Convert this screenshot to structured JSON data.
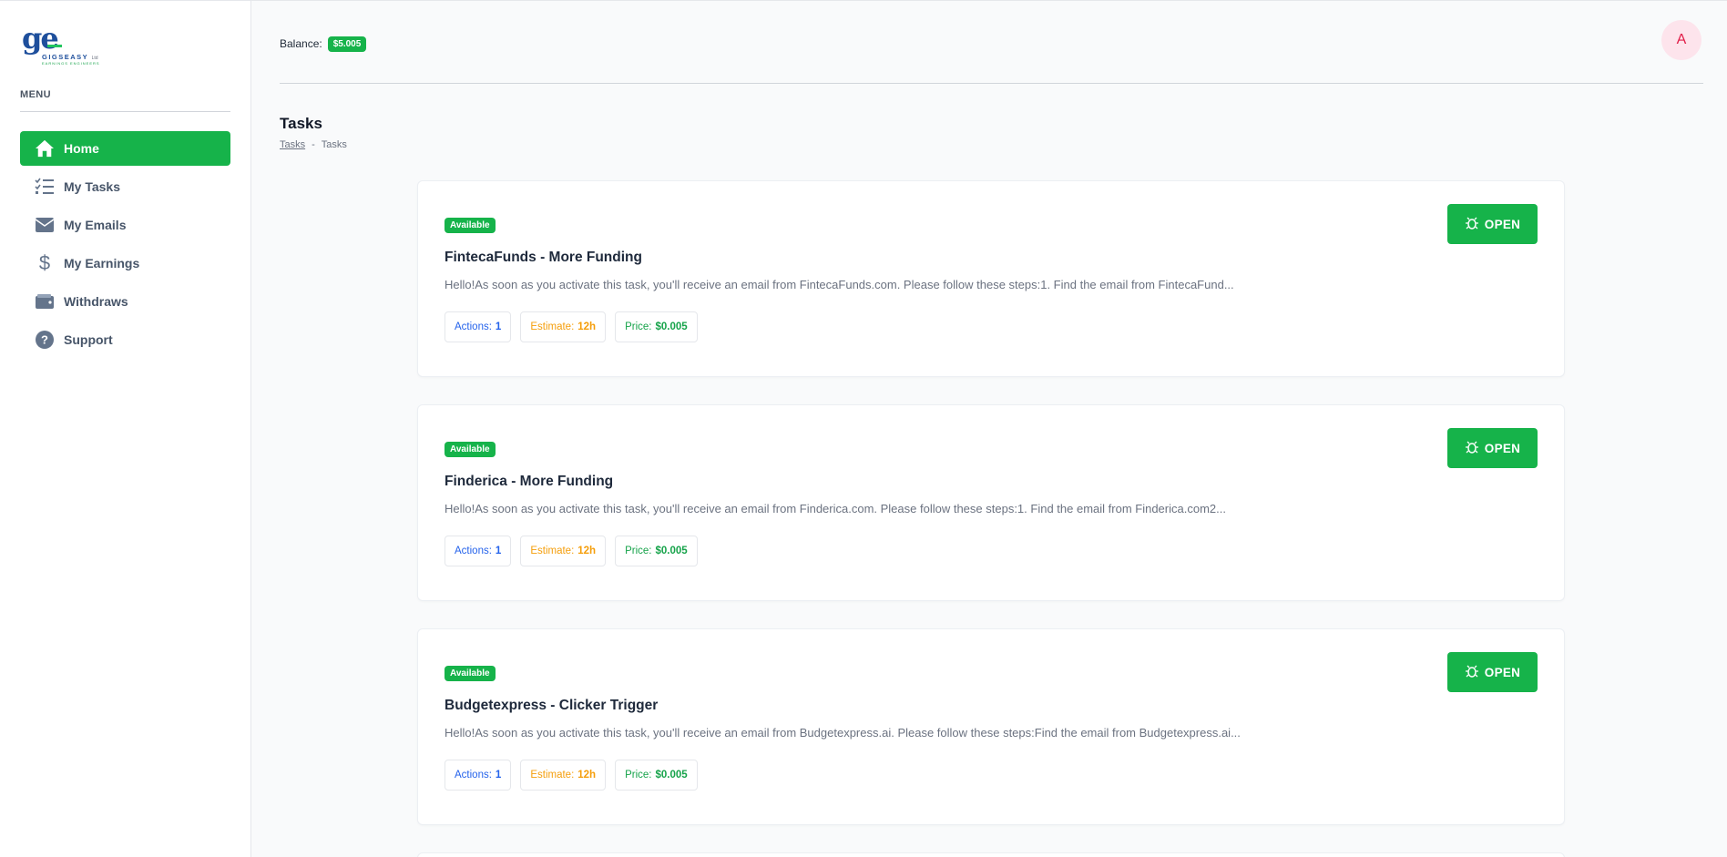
{
  "logo": {
    "mark": "ge",
    "wordmark": "GIGSEASY",
    "suffix": "Ltd",
    "tagline": "EARNINGS ENGINEERS"
  },
  "sidebar": {
    "menu_title": "MENU",
    "items": [
      {
        "label": "Home",
        "icon": "home-icon",
        "active": true
      },
      {
        "label": "My Tasks",
        "icon": "task-list-icon",
        "active": false
      },
      {
        "label": "My Emails",
        "icon": "envelope-icon",
        "active": false
      },
      {
        "label": "My Earnings",
        "icon": "dollar-icon",
        "active": false
      },
      {
        "label": "Withdraws",
        "icon": "wallet-icon",
        "active": false
      },
      {
        "label": "Support",
        "icon": "question-icon",
        "active": false
      }
    ]
  },
  "header": {
    "balance_label": "Balance:",
    "balance_value": "$5.005",
    "avatar_initial": "A"
  },
  "page": {
    "title": "Tasks",
    "breadcrumb": [
      "Tasks",
      "-",
      "Tasks"
    ]
  },
  "tasks": [
    {
      "status": "Available",
      "title": "FintecaFunds - More Funding",
      "description": "Hello!As soon as you activate this task, you'll receive an email from FintecaFunds.com. Please follow these steps:1.   Find the email from FintecaFund...",
      "actions_label": "Actions:",
      "actions_value": "1",
      "estimate_label": "Estimate:",
      "estimate_value": "12h",
      "price_label": "Price:",
      "price_value": "$0.005",
      "button_label": "OPEN"
    },
    {
      "status": "Available",
      "title": "Finderica - More Funding",
      "description": "Hello!As soon as you activate this task, you'll receive an email from Finderica.com. Please follow these steps:1.   Find the email from Finderica.com2...",
      "actions_label": "Actions:",
      "actions_value": "1",
      "estimate_label": "Estimate:",
      "estimate_value": "12h",
      "price_label": "Price:",
      "price_value": "$0.005",
      "button_label": "OPEN"
    },
    {
      "status": "Available",
      "title": "Budgetexpress - Clicker Trigger",
      "description": "Hello!As soon as you activate this task, you'll receive an email from Budgetexpress.ai. Please follow these steps:Find the email from Budgetexpress.ai...",
      "actions_label": "Actions:",
      "actions_value": "1",
      "estimate_label": "Estimate:",
      "estimate_value": "12h",
      "price_label": "Price:",
      "price_value": "$0.005",
      "button_label": "OPEN"
    }
  ],
  "colors": {
    "accent": "#16b34a",
    "avatar_bg": "#fde4ec",
    "avatar_fg": "#e11d48"
  }
}
